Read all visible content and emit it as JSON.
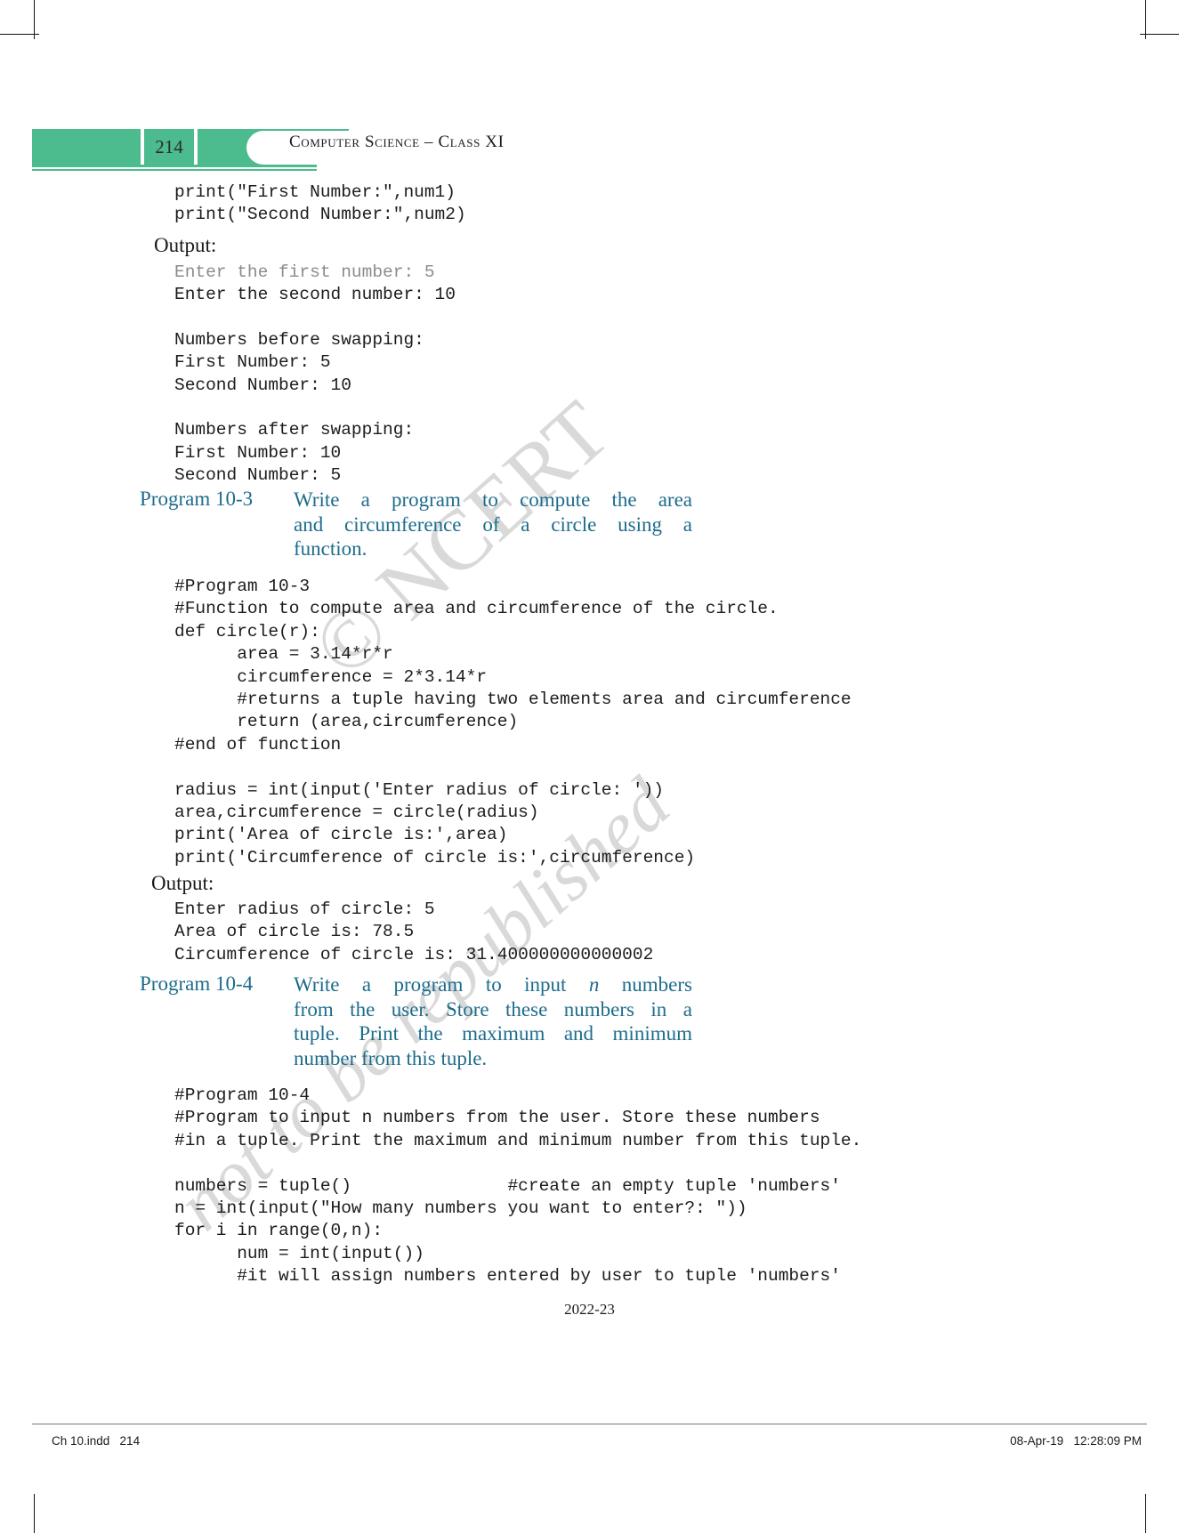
{
  "header": {
    "page_number": "214",
    "title": "Computer Science – Class XI",
    "accent_color": "#4cbb8d"
  },
  "watermarks": {
    "line1": "© NCERT",
    "line2": "not to be republished"
  },
  "theme": {
    "heading_color": "#1d6c8c",
    "code_color": "#1c1c1c",
    "dim_code_color": "#8c8c8c"
  },
  "body": {
    "code_top": "print(\"First Number:\",num1)\nprint(\"Second Number:\",num2)",
    "output_label_1": "Output:",
    "output_1_dim": "Enter the first number: 5",
    "output_1_rest": "Enter the second number: 10\n\nNumbers before swapping:\nFirst Number: 5\nSecond Number: 10\n\nNumbers after swapping:\nFirst Number: 10\nSecond Number: 5",
    "program_10_3": {
      "number": "Program 10-3",
      "desc_line1": "Write a program to compute the area",
      "desc_line2": "and circumference of a circle using a",
      "desc_line3": "function."
    },
    "code_10_3": "#Program 10-3\n#Function to compute area and circumference of the circle.\ndef circle(r):\n      area = 3.14*r*r\n      circumference = 2*3.14*r\n      #returns a tuple having two elements area and circumference\n      return (area,circumference)\n#end of function\n\nradius = int(input('Enter radius of circle: '))\narea,circumference = circle(radius)\nprint('Area of circle is:',area)\nprint('Circumference of circle is:',circumference)",
    "output_label_2": "Output:",
    "output_2": "Enter radius of circle: 5\nArea of circle is: 78.5\nCircumference of circle is: 31.400000000000002",
    "program_10_4": {
      "number": "Program 10-4",
      "desc_line1_a": "Write a program to input ",
      "desc_line1_n": "n",
      "desc_line1_b": "  numbers",
      "desc_line2": "from the user. Store these numbers in a",
      "desc_line3": "tuple. Print the maximum and minimum",
      "desc_line4": "number from this tuple."
    },
    "code_10_4": "#Program 10-4\n#Program to input n numbers from the user. Store these numbers\n#in a tuple. Print the maximum and minimum number from this tuple.\n\nnumbers = tuple()               #create an empty tuple 'numbers'\nn = int(input(\"How many numbers you want to enter?: \"))\nfor i in range(0,n):\n      num = int(input())\n      #it will assign numbers entered by user to tuple 'numbers'"
  },
  "footer": {
    "year": "2022-23",
    "file_info": "Ch 10.indd   214",
    "timestamp": "08-Apr-19   12:28:09 PM"
  }
}
